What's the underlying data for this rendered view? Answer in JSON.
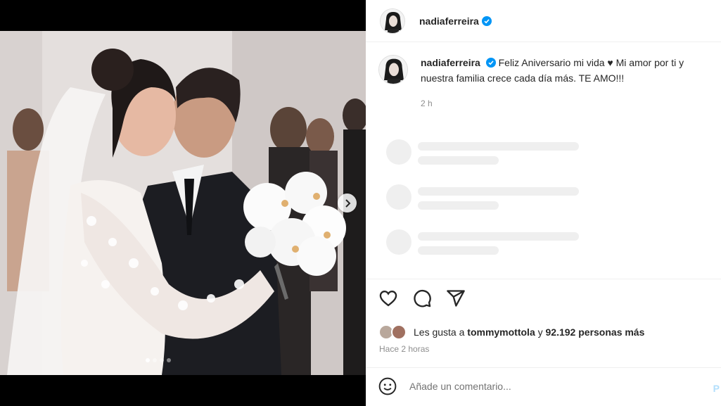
{
  "header": {
    "username": "nadiaferreira",
    "verified_icon": "verified-badge-icon"
  },
  "caption": {
    "username": "nadiaferreira",
    "text": "Feliz Aniversario mi vida ♥ Mi amor por ti y nuestra familia crece cada día más. TE AMO!!!",
    "time": "2 h"
  },
  "media": {
    "carousel_total": 4,
    "carousel_active": 1,
    "next_icon": "chevron-right-icon"
  },
  "actions": {
    "like_icon": "heart-icon",
    "comment_icon": "comment-icon",
    "share_icon": "send-icon"
  },
  "likes": {
    "prefix": "Les gusta a",
    "user": "tommymottola",
    "connector": "y",
    "count": "92.192 personas más"
  },
  "timestamp": "Hace 2 horas",
  "comment": {
    "placeholder": "Añade un comentario...",
    "post_label": "P",
    "emoji_icon": "emoji-icon"
  },
  "colors": {
    "verified": "#0095f6",
    "text": "#262626",
    "muted": "#8e8e8e",
    "skeleton": "#efefef"
  }
}
